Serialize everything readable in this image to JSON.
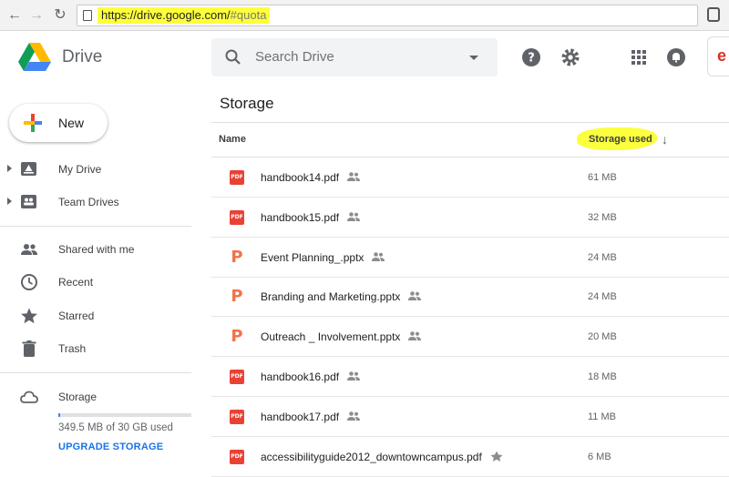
{
  "browser": {
    "url_scheme": "https://",
    "url_host": "drive.google.com/",
    "url_fragment": "#quota",
    "back_icon": "arrow-left-icon",
    "forward_icon": "arrow-right-icon",
    "reload_icon": "reload-icon"
  },
  "header": {
    "brand": "Drive",
    "search_placeholder": "Search Drive"
  },
  "sidebar": {
    "new_label": "New",
    "items": [
      {
        "label": "My Drive",
        "icon": "my-drive-icon"
      },
      {
        "label": "Team Drives",
        "icon": "team-drives-icon"
      },
      {
        "label": "Shared with me",
        "icon": "shared-people-icon"
      },
      {
        "label": "Recent",
        "icon": "clock-icon"
      },
      {
        "label": "Starred",
        "icon": "star-icon"
      },
      {
        "label": "Trash",
        "icon": "trash-icon"
      },
      {
        "label": "Storage",
        "icon": "cloud-icon"
      }
    ],
    "storage_used_fraction": 0.0117,
    "storage_text": "349.5 MB of 30 GB used",
    "upgrade_label": "UPGRADE STORAGE"
  },
  "main": {
    "title": "Storage",
    "col_name": "Name",
    "col_storage": "Storage used",
    "files": [
      {
        "name": "handbook14.pdf",
        "type": "pdf",
        "size": "61 MB",
        "shared": true
      },
      {
        "name": "handbook15.pdf",
        "type": "pdf",
        "size": "32 MB",
        "shared": true
      },
      {
        "name": "Event Planning_.pptx",
        "type": "pptx",
        "size": "24 MB",
        "shared": true
      },
      {
        "name": "Branding and Marketing.pptx",
        "type": "pptx",
        "size": "24 MB",
        "shared": true
      },
      {
        "name": "Outreach _ Involvement.pptx",
        "type": "pptx",
        "size": "20 MB",
        "shared": true
      },
      {
        "name": "handbook16.pdf",
        "type": "pdf",
        "size": "18 MB",
        "shared": true
      },
      {
        "name": "handbook17.pdf",
        "type": "pdf",
        "size": "11 MB",
        "shared": true
      },
      {
        "name": "accessibilityguide2012_downtowncampus.pdf",
        "type": "pdf",
        "size": "6 MB",
        "shared": false
      }
    ],
    "pdf_badge": "PDF",
    "ppt_badge": "P"
  },
  "colors": {
    "accent": "#1a73e8",
    "pdf": "#e94235",
    "pptx": "#f4714a",
    "highlight": "#ffff3b"
  }
}
